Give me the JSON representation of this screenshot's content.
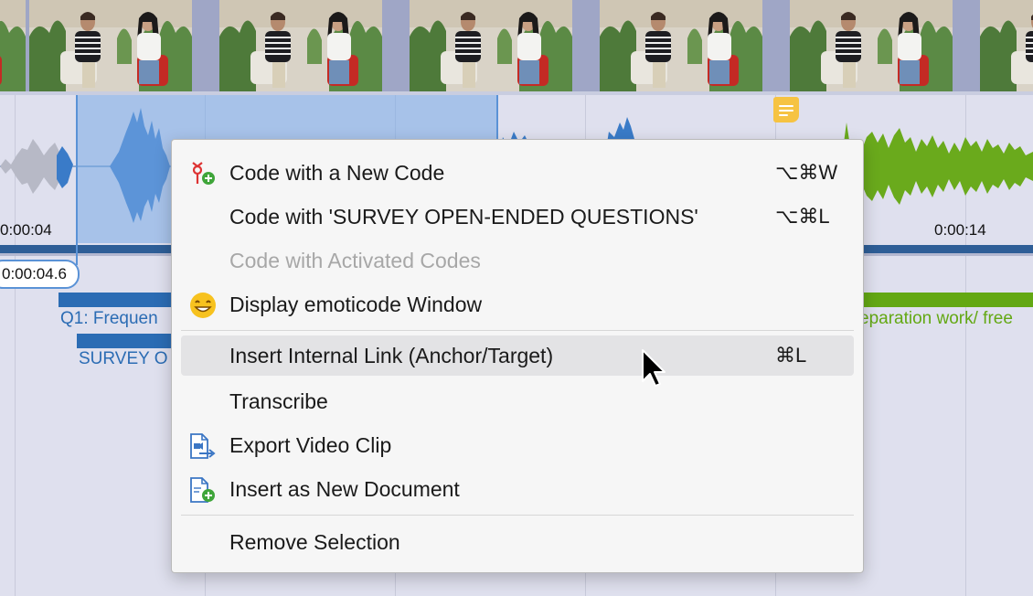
{
  "timeline": {
    "tick_left": "0:00:04",
    "tick_right": "0:00:14",
    "playhead_time": "0:00:04.6",
    "codes": [
      {
        "label": "Q1: Frequen",
        "color": "#2b6cb4"
      },
      {
        "label": "SURVEY O",
        "color": "#2b6cb4"
      },
      {
        "label": "eparation work/ free",
        "color": "#63a813"
      }
    ]
  },
  "context_menu": {
    "items": [
      {
        "label": "Code with a New Code",
        "shortcut": "⌥⌘W",
        "icon": "new-code-icon"
      },
      {
        "label": "Code with 'SURVEY OPEN-ENDED QUESTIONS'",
        "shortcut": "⌥⌘L"
      },
      {
        "label": "Code with Activated Codes",
        "disabled": true
      },
      {
        "label": "Display emoticode Window",
        "icon": "emoticode-smiley-icon"
      },
      {
        "label": "Insert Internal Link (Anchor/Target)",
        "shortcut": "⌘L",
        "highlighted": true
      },
      {
        "label": "Transcribe"
      },
      {
        "label": "Export Video Clip",
        "icon": "export-video-clip-icon"
      },
      {
        "label": "Insert as New Document",
        "icon": "new-document-icon"
      },
      {
        "label": "Remove Selection"
      }
    ]
  }
}
